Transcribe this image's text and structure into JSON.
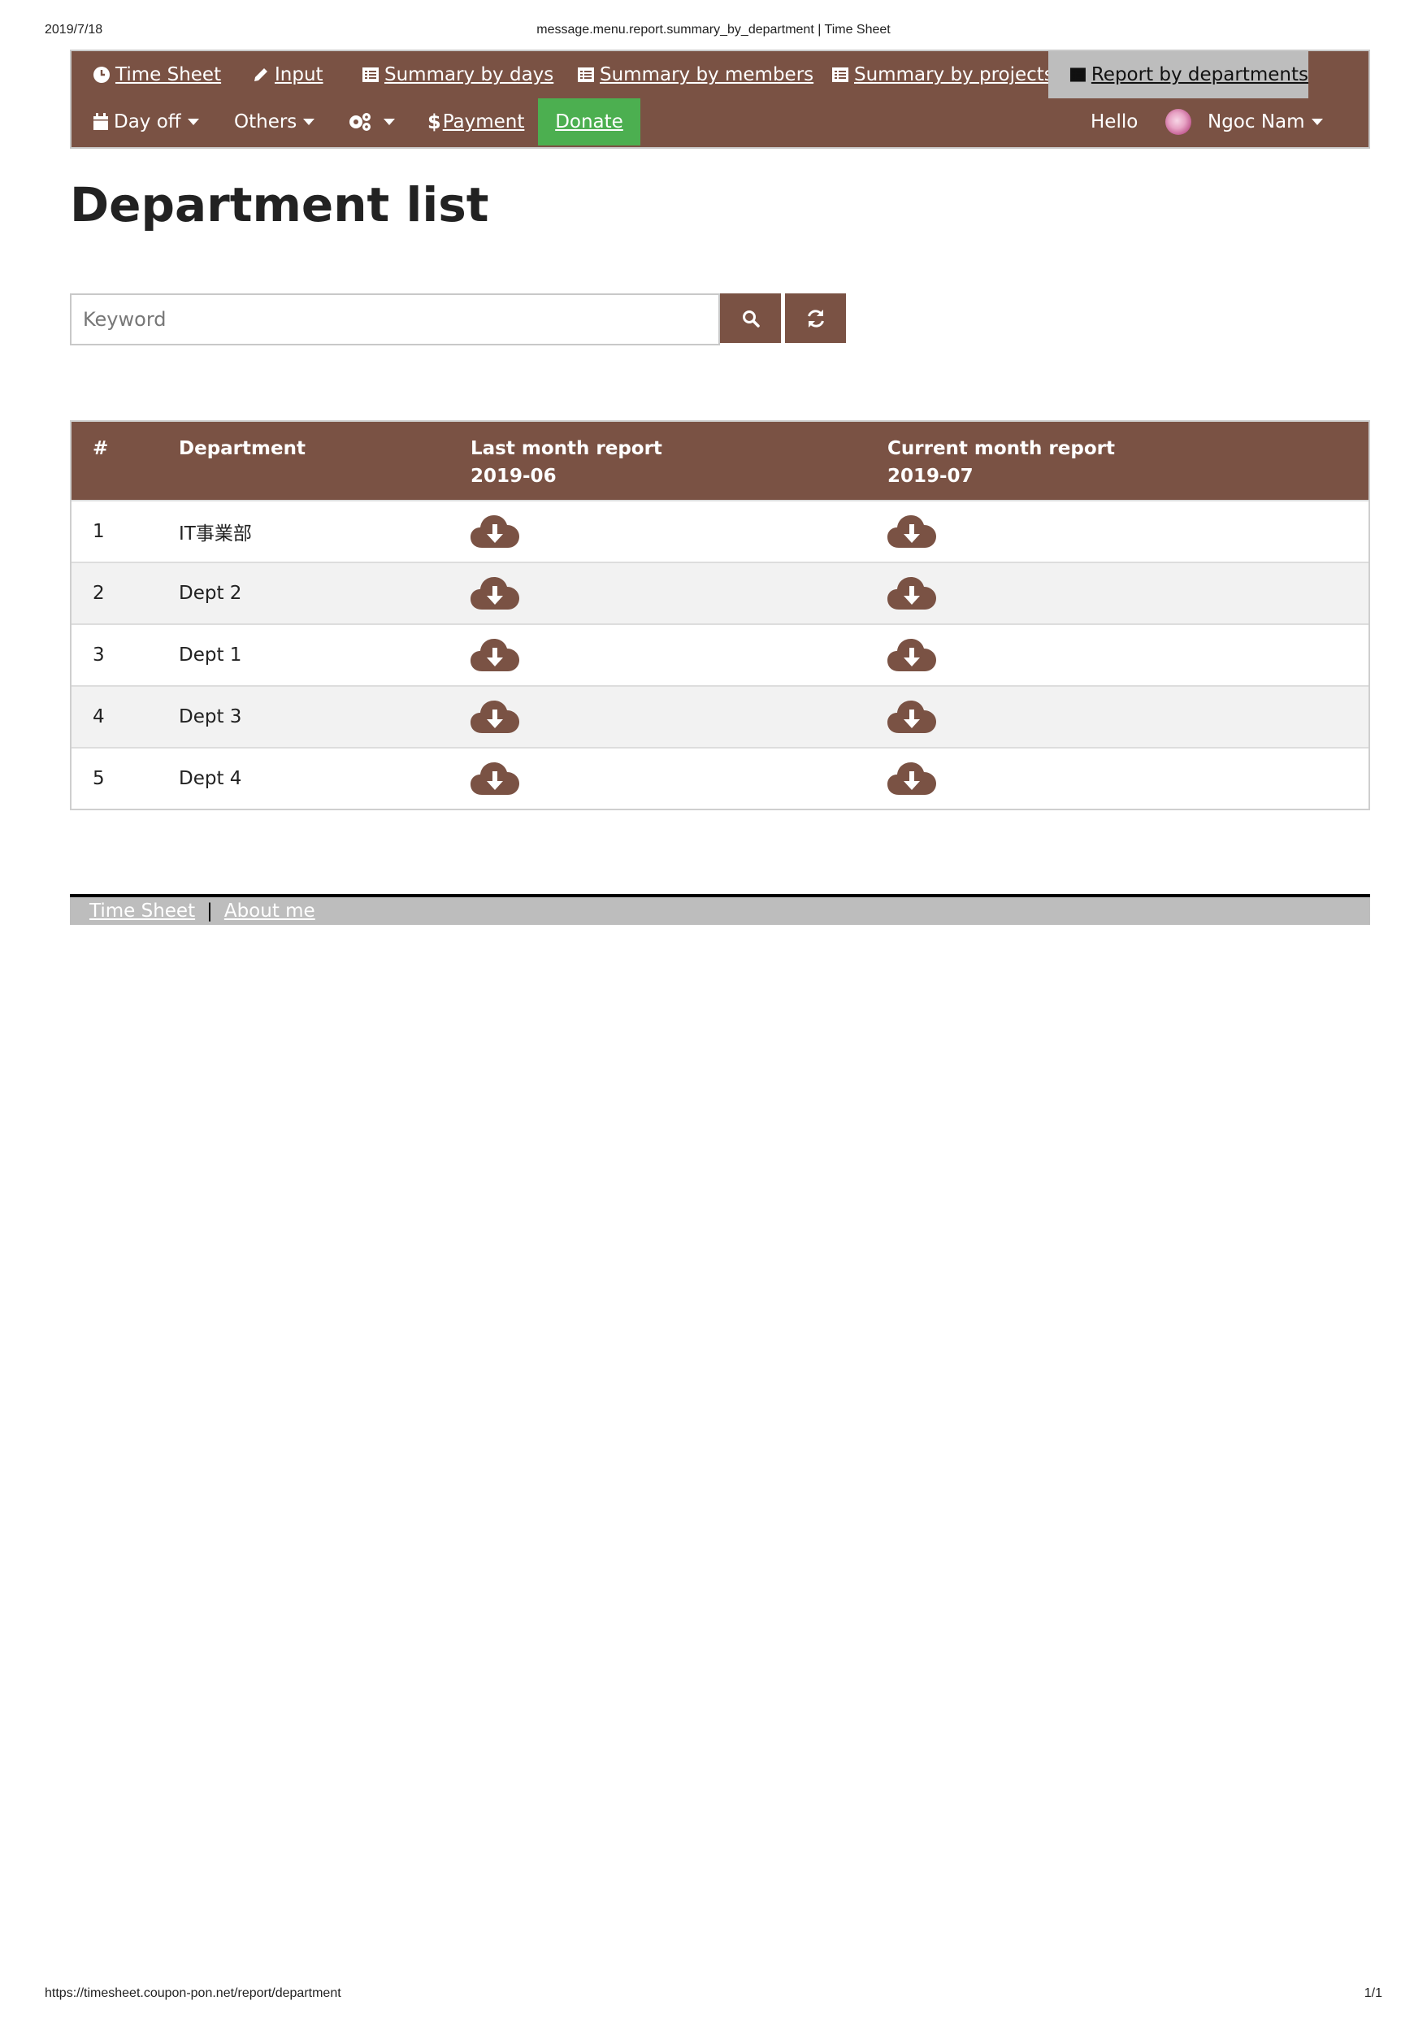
{
  "print": {
    "date": "2019/7/18",
    "title": "message.menu.report.summary_by_department | Time Sheet",
    "url": "https://timesheet.coupon-pon.net/report/department",
    "pages": "1/1"
  },
  "nav": {
    "row1": [
      {
        "label": "Time Sheet",
        "icon": "clock-icon"
      },
      {
        "label": "Input",
        "icon": "pencil-icon"
      },
      {
        "label": "Summary by days",
        "icon": "list-icon"
      },
      {
        "label": "Summary by members",
        "icon": "list-icon"
      },
      {
        "label": "Summary by projects",
        "icon": "list-icon"
      },
      {
        "label": "Report by departments",
        "icon": "list-icon",
        "active": true
      }
    ],
    "row2": {
      "dayoff": "Day off",
      "others": "Others",
      "payment": "Payment",
      "donate": "Donate",
      "hello": "Hello",
      "user": "Ngoc Nam"
    }
  },
  "page": {
    "title": "Department list"
  },
  "search": {
    "placeholder": "Keyword",
    "value": ""
  },
  "table": {
    "headers": {
      "num": "#",
      "department": "Department",
      "last_month": "Last month report",
      "last_month_date": "2019-06",
      "current_month": "Current month report",
      "current_month_date": "2019-07"
    },
    "rows": [
      {
        "num": "1",
        "department": "IT事業部"
      },
      {
        "num": "2",
        "department": "Dept 2"
      },
      {
        "num": "3",
        "department": "Dept 1"
      },
      {
        "num": "4",
        "department": "Dept 3"
      },
      {
        "num": "5",
        "department": "Dept 4"
      }
    ]
  },
  "footer": {
    "link1": "Time Sheet",
    "separator": "|",
    "link2": "About me"
  },
  "colors": {
    "brand": "#7a5244",
    "active_tab": "#bdbdbd",
    "donate": "#4caf50",
    "footer": "#bdbdbd"
  }
}
